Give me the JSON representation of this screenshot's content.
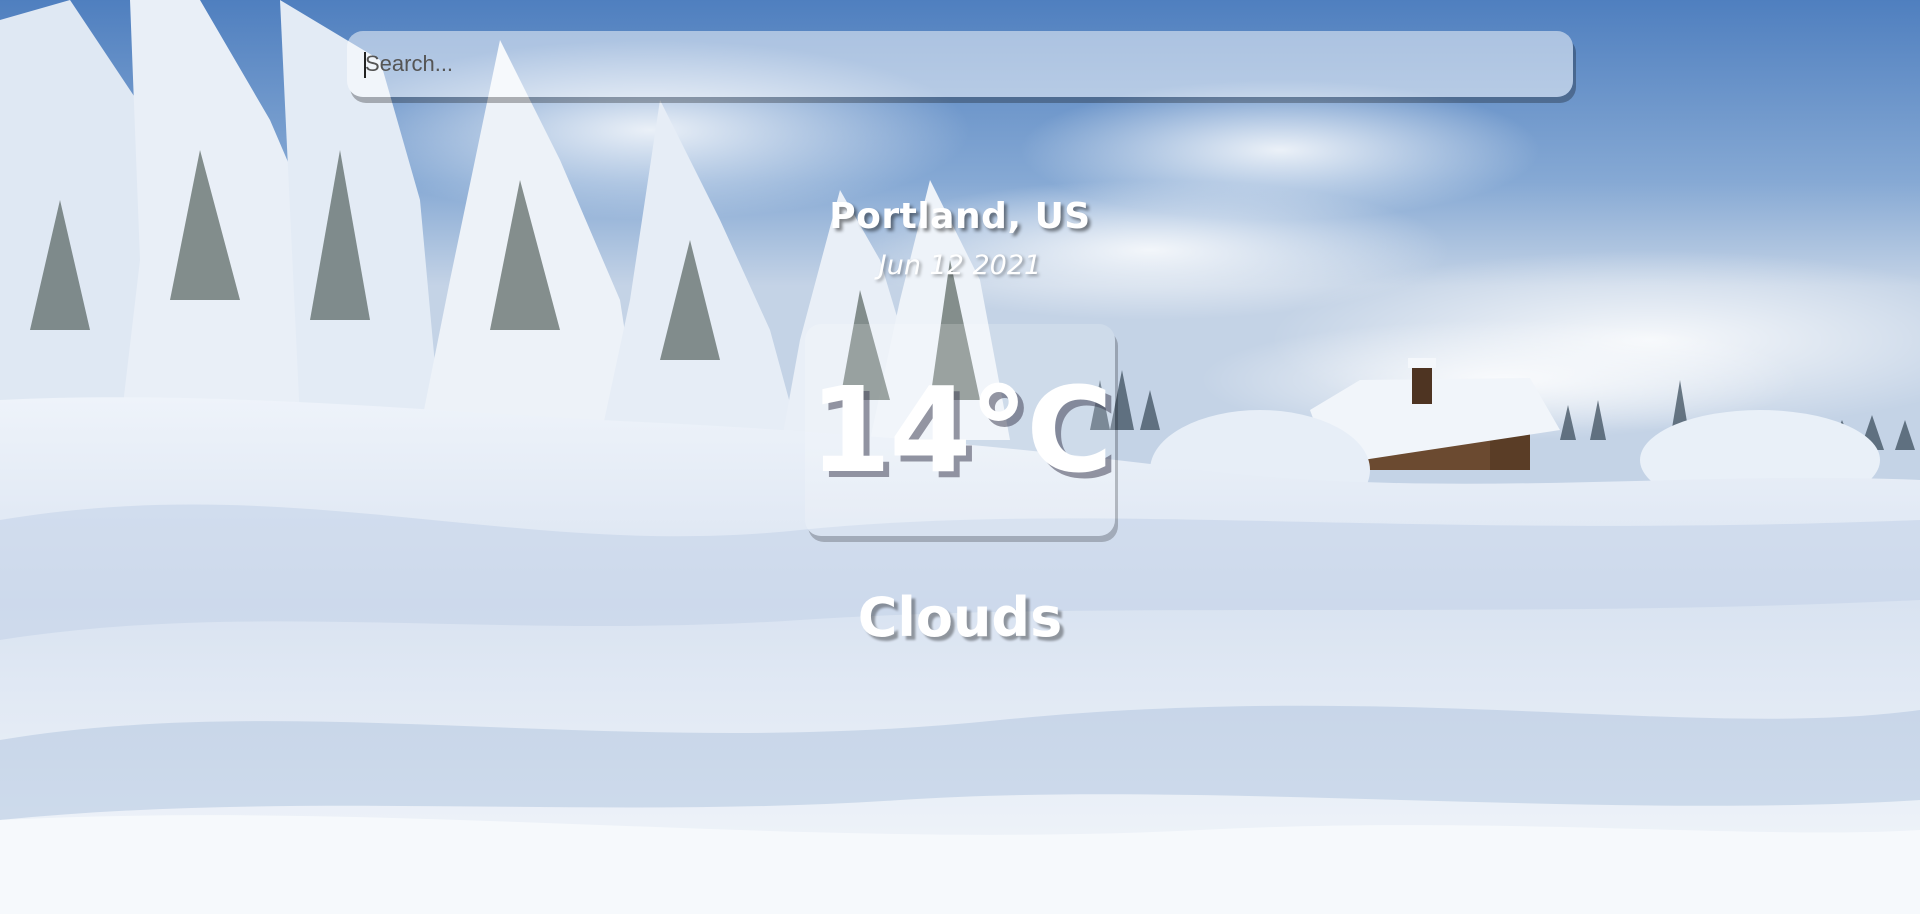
{
  "search": {
    "placeholder": "Search..."
  },
  "weather": {
    "location": "Portland, US",
    "date": "Jun 12 2021",
    "temperature": "14°C",
    "condition": "Clouds"
  },
  "colors": {
    "sky_top": "#5b88c2",
    "sky_light": "#c9d8ea",
    "snow_light": "#f3f6fb",
    "snow_shadow": "#98b0d0",
    "text": "#ffffff"
  },
  "background": {
    "scene": "snowy-winter-landscape"
  }
}
